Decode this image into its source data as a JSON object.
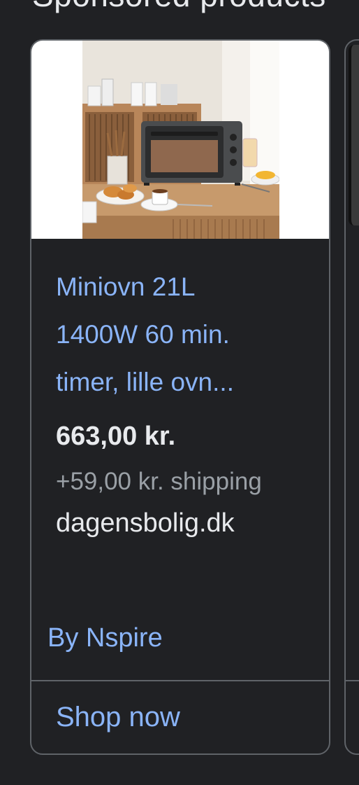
{
  "section": {
    "heading": "Sponsored products"
  },
  "product": {
    "image_icon": "toaster-oven-product-photo",
    "title": "Miniovn 21L 1400W 60 min. timer, lille ovn...",
    "price": "663,00 kr.",
    "shipping": "+59,00 kr. shipping",
    "merchant": "dagensbolig.dk",
    "by_line": "By Nspire",
    "cta_label": "Shop now"
  },
  "colors": {
    "background": "#202124",
    "link": "#8ab4f8",
    "text_primary": "#e8eaed",
    "text_secondary": "#9aa0a6",
    "border": "#5f6368"
  }
}
